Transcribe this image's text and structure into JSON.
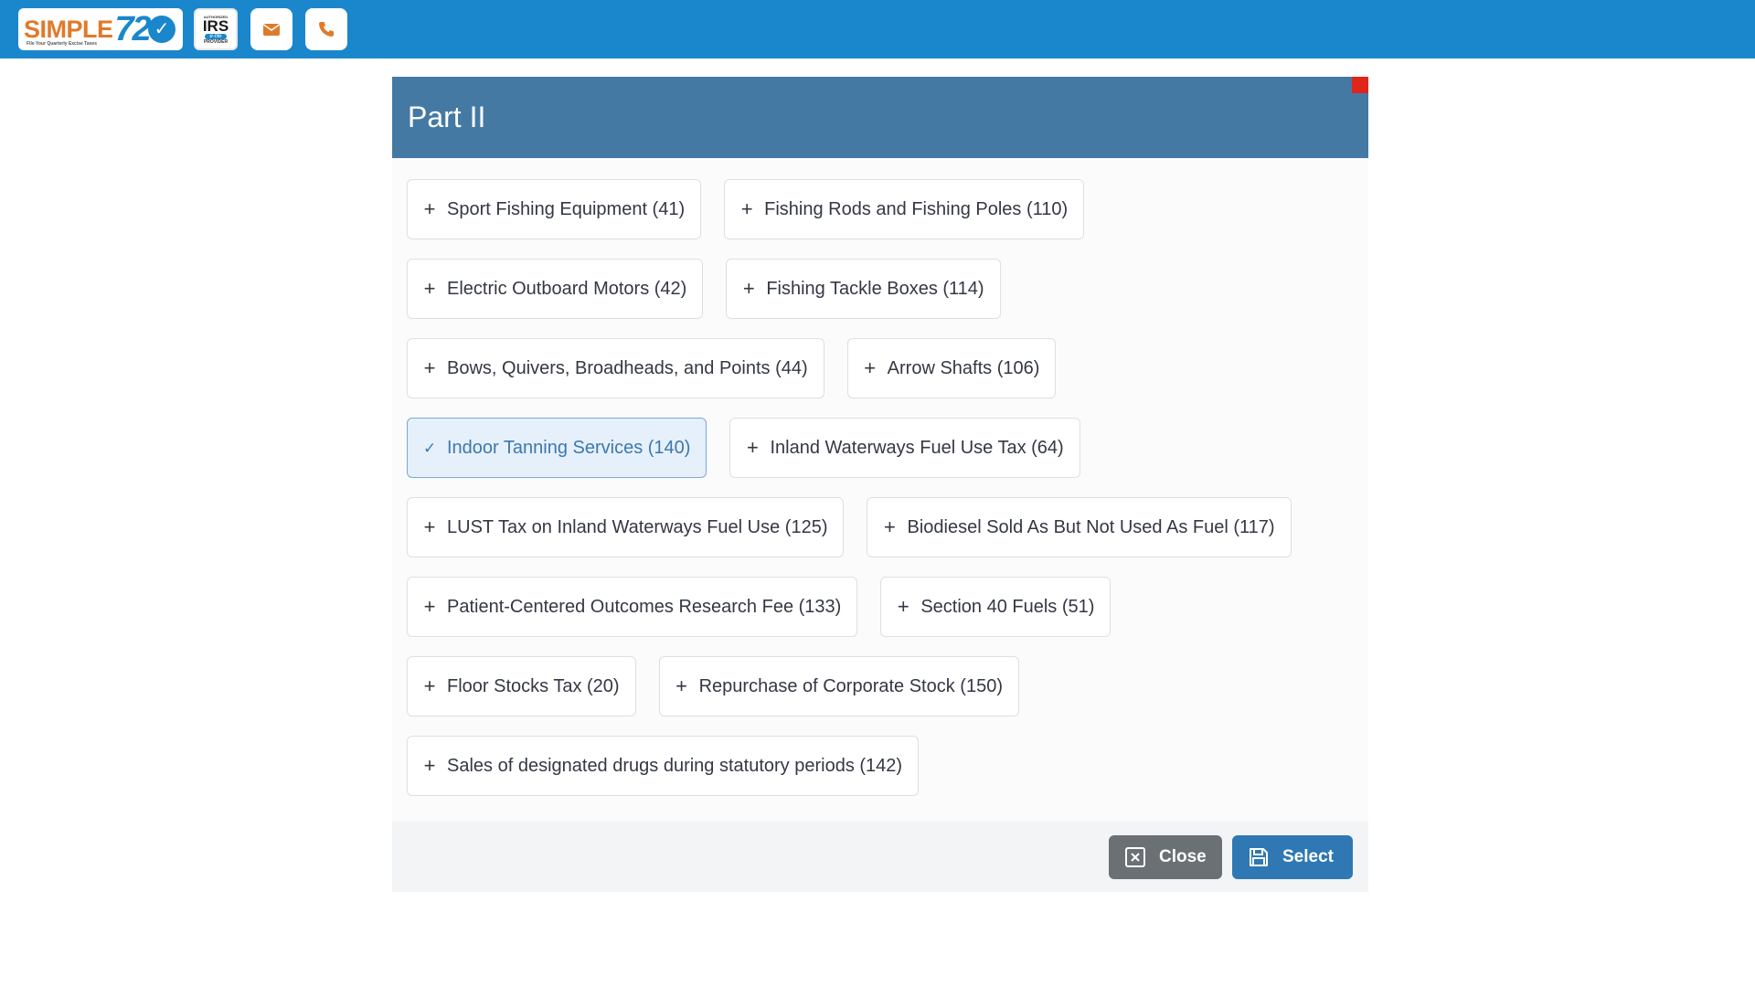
{
  "header": {
    "logo_word": "SIMPLE",
    "logo_number": "720",
    "logo_tagline": "File Your Quarterly Excise Taxes",
    "irs_badge": {
      "top": "AUTHORIZED",
      "main": "IRS",
      "efile": "e-file",
      "bottom": "PROVIDER"
    },
    "icons": [
      "envelope-icon",
      "phone-icon"
    ],
    "bar_color": "#1a87cc"
  },
  "modal": {
    "title": "Part II",
    "header_color": "#4479a3",
    "rows": [
      [
        {
          "label": "Sport Fishing Equipment (41)",
          "selected": false
        },
        {
          "label": "Fishing Rods and Fishing Poles (110)",
          "selected": false
        }
      ],
      [
        {
          "label": "Electric Outboard Motors (42)",
          "selected": false
        },
        {
          "label": "Fishing Tackle Boxes (114)",
          "selected": false
        }
      ],
      [
        {
          "label": "Bows, Quivers, Broadheads, and Points (44)",
          "selected": false
        },
        {
          "label": "Arrow Shafts (106)",
          "selected": false
        }
      ],
      [
        {
          "label": "Indoor Tanning Services (140)",
          "selected": true
        },
        {
          "label": "Inland Waterways Fuel Use Tax (64)",
          "selected": false
        }
      ],
      [
        {
          "label": "LUST Tax on Inland Waterways Fuel Use (125)",
          "selected": false
        },
        {
          "label": "Biodiesel Sold As But Not Used As Fuel (117)",
          "selected": false
        }
      ],
      [
        {
          "label": "Patient-Centered Outcomes Research Fee (133)",
          "selected": false
        },
        {
          "label": "Section 40 Fuels (51)",
          "selected": false
        }
      ],
      [
        {
          "label": "Floor Stocks Tax (20)",
          "selected": false
        },
        {
          "label": "Repurchase of Corporate Stock (150)",
          "selected": false
        }
      ],
      [
        {
          "label": "Sales of designated drugs during statutory periods (142)",
          "selected": false
        }
      ]
    ],
    "footer": {
      "close_label": "Close",
      "select_label": "Select"
    }
  }
}
